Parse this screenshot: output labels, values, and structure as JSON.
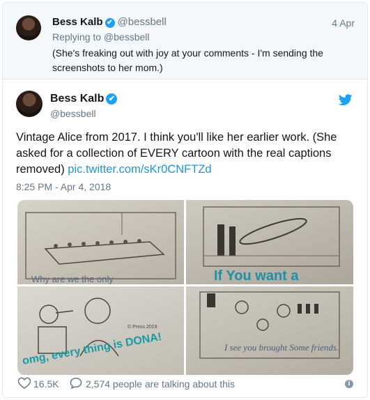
{
  "reply": {
    "name": "Bess Kalb",
    "verified_mark": "✔",
    "handle": "@bessbell",
    "date": "4 Apr",
    "replying_to": "Replying to @bessbell",
    "text": "(She's freaking out with joy at your comments - I'm sending the screenshots to her mom.)"
  },
  "tweet": {
    "name": "Bess Kalb",
    "verified_mark": "✔",
    "handle": "@bessbell",
    "text": "Vintage Alice from 2017. I think you'll like her earlier work. (She asked for a collection of EVERY cartoon with the real captions removed)",
    "link": "pic.twitter.com/sKr0CNFTZd",
    "timestamp": "8:25 PM - Apr 4, 2018",
    "photos": [
      {
        "caption": "Why are we the only"
      },
      {
        "caption": "If You want a"
      },
      {
        "caption": "omg, every thing is DONA!"
      },
      {
        "caption": "I see you brought Some friends."
      }
    ],
    "likes": "16.5K",
    "talking": "2,574 people are talking about this",
    "info_mark": "i"
  },
  "icons": {
    "verified": "verified-badge-icon",
    "bird": "twitter-bird-icon",
    "heart": "heart-icon",
    "reply": "reply-bubble-icon",
    "info": "info-icon"
  },
  "colors": {
    "accent": "#1da1f2",
    "link": "#1b95e0",
    "muted": "#657786",
    "reply_bg": "#f5f8fa"
  }
}
